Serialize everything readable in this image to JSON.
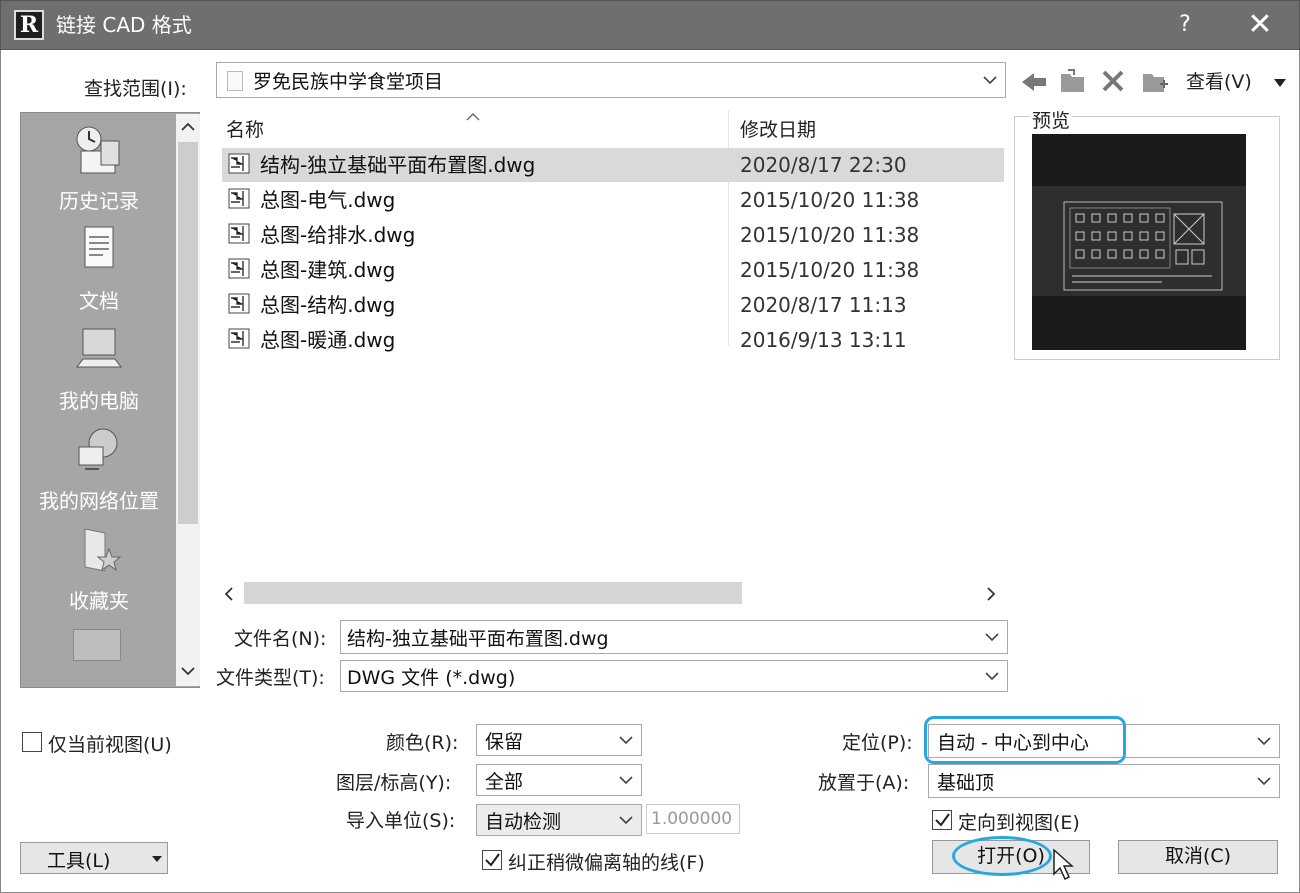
{
  "window": {
    "title": "链接 CAD 格式",
    "help": "?",
    "close": "✕"
  },
  "lookin": {
    "label": "查找范围(I):",
    "value": "罗免民族中学食堂项目",
    "views": "查看(V)"
  },
  "places": [
    {
      "label": "历史记录",
      "icon": "history-icon"
    },
    {
      "label": "文档",
      "icon": "documents-icon"
    },
    {
      "label": "我的电脑",
      "icon": "computer-icon"
    },
    {
      "label": "我的网络位置",
      "icon": "network-icon"
    },
    {
      "label": "收藏夹",
      "icon": "favorites-icon"
    }
  ],
  "list": {
    "col_name": "名称",
    "col_date": "修改日期",
    "files": [
      {
        "name": "结构-独立基础平面布置图.dwg",
        "date": "2020/8/17 22:30"
      },
      {
        "name": "总图-电气.dwg",
        "date": "2015/10/20 11:38"
      },
      {
        "name": "总图-给排水.dwg",
        "date": "2015/10/20 11:38"
      },
      {
        "name": "总图-建筑.dwg",
        "date": "2015/10/20 11:38"
      },
      {
        "name": "总图-结构.dwg",
        "date": "2020/8/17 11:13"
      },
      {
        "name": "总图-暖通.dwg",
        "date": "2016/9/13 13:11"
      }
    ]
  },
  "preview": {
    "label": "预览"
  },
  "filename": {
    "label": "文件名(N):",
    "value": "结构-独立基础平面布置图.dwg"
  },
  "filetype": {
    "label": "文件类型(T):",
    "value": "DWG 文件 (*.dwg)"
  },
  "options": {
    "current_view": "仅当前视图(U)",
    "color_label": "颜色(R):",
    "color_value": "保留",
    "layers_label": "图层/标高(Y):",
    "layers_value": "全部",
    "units_label": "导入单位(S):",
    "units_value": "自动检测",
    "scale_value": "1.000000",
    "correct_lines": "纠正稍微偏离轴的线(F)",
    "position_label": "定位(P):",
    "position_value": "自动 - 中心到中心",
    "place_at_label": "放置于(A):",
    "place_at_value": "基础顶",
    "orient_view": "定向到视图(E)"
  },
  "buttons": {
    "tools": "工具(L)",
    "open": "打开(O)",
    "cancel": "取消(C)"
  },
  "colors": {
    "titlebar": "#6f6f6f",
    "highlight": "#26a7e1",
    "places_bg": "#a6a6a6",
    "selected_row": "#d9d9d9"
  }
}
